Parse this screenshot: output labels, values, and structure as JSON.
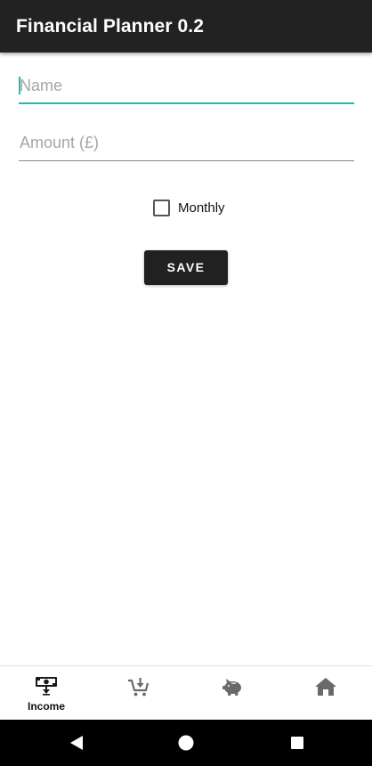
{
  "app_bar": {
    "title": "Financial Planner 0.2"
  },
  "form": {
    "name_placeholder": "Name",
    "amount_placeholder": "Amount (£)",
    "monthly_label": "Monthly",
    "monthly_checked": false,
    "save_label": "SAVE"
  },
  "bottom_nav": {
    "items": [
      {
        "label": "Income",
        "icon": "income-icon",
        "selected": true
      },
      {
        "label": "",
        "icon": "shopping-cart-icon",
        "selected": false
      },
      {
        "label": "",
        "icon": "piggy-bank-icon",
        "selected": false
      },
      {
        "label": "",
        "icon": "home-icon",
        "selected": false
      }
    ]
  },
  "system_nav": {
    "buttons": [
      "back-icon",
      "home-circle-icon",
      "recents-icon"
    ]
  },
  "colors": {
    "app_bar": "#222222",
    "accent": "#1fbfb0",
    "button": "#212121"
  }
}
